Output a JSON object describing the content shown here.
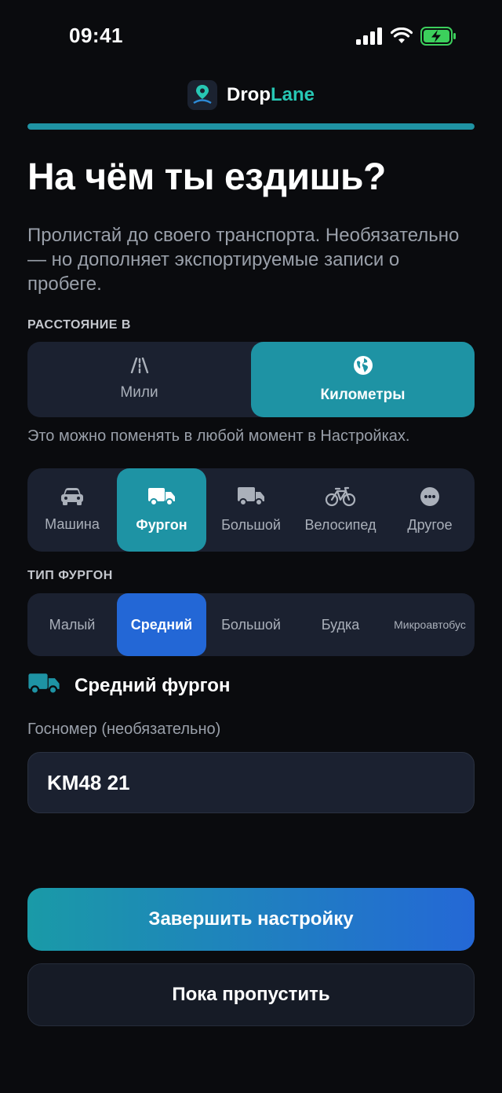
{
  "status_bar": {
    "time": "09:41"
  },
  "brand": {
    "name_part1": "Drop",
    "name_part2": "Lane",
    "accent_color": "#27c7b4"
  },
  "progress": {
    "fraction": 1.0
  },
  "header": {
    "title": "На чём ты ездишь?",
    "subtitle": "Пролистай до своего транспорта. Необязательно — но дополняет экспортируемые записи о пробеге."
  },
  "units": {
    "section_label": "РАССТОЯНИЕ В",
    "options": [
      {
        "label": "Мили",
        "icon": "road-icon",
        "selected": false
      },
      {
        "label": "Километры",
        "icon": "globe-icon",
        "selected": true
      }
    ],
    "hint": "Это можно поменять в любой момент в Настройках."
  },
  "vehicles": {
    "options": [
      {
        "label": "Машина",
        "icon": "car-icon",
        "selected": false
      },
      {
        "label": "Фургон",
        "icon": "van-icon",
        "selected": true
      },
      {
        "label": "Большой",
        "icon": "truck-icon",
        "selected": false
      },
      {
        "label": "Велосипед",
        "icon": "bicycle-icon",
        "selected": false
      },
      {
        "label": "Другое",
        "icon": "more-icon",
        "selected": false
      }
    ]
  },
  "van_type": {
    "section_label": "ТИП ФУРГОН",
    "options": [
      {
        "label": "Малый",
        "selected": false
      },
      {
        "label": "Средний",
        "selected": true
      },
      {
        "label": "Большой",
        "selected": false
      },
      {
        "label": "Будка",
        "selected": false
      },
      {
        "label": "Микроавтобус",
        "selected": false
      }
    ],
    "selected_summary": "Средний фургон"
  },
  "plate": {
    "label": "Госномер (необязательно)",
    "value": "KM48 21"
  },
  "actions": {
    "primary_label": "Завершить настройку",
    "secondary_label": "Пока пропустить"
  },
  "colors": {
    "teal": "#1e93a4",
    "blue": "#2367d6",
    "background": "#0a0b0e",
    "card": "#1b2130"
  }
}
